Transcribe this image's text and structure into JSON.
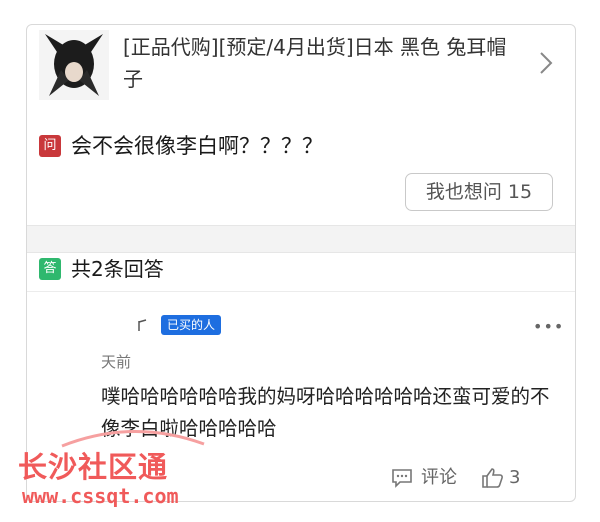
{
  "product": {
    "title": "[正品代购][预定/4月出货]日本 黑色 兔耳帽子",
    "thumbnail_icon": "product-photo"
  },
  "question": {
    "tag_label": "问",
    "text": "会不会很像李白啊？？？？",
    "ask_button_label": "我也想问 15"
  },
  "answers": {
    "tag_label": "答",
    "count_label": "共2条回答",
    "item": {
      "buyer_badge": "已买的人",
      "time": "天前",
      "text": "噗哈哈哈哈哈哈我的妈呀哈哈哈哈哈哈还蛮可爱的不像李白啦哈哈哈哈哈",
      "comment_label": "评论",
      "like_count": "3"
    }
  },
  "watermark": {
    "name": "长沙社区通",
    "url": "www.cssqt.com"
  },
  "colors": {
    "question_tag": "#c9383b",
    "answer_tag": "#2fb86e",
    "buyer_badge": "#1e6ee0",
    "watermark": "#f05a5a"
  }
}
